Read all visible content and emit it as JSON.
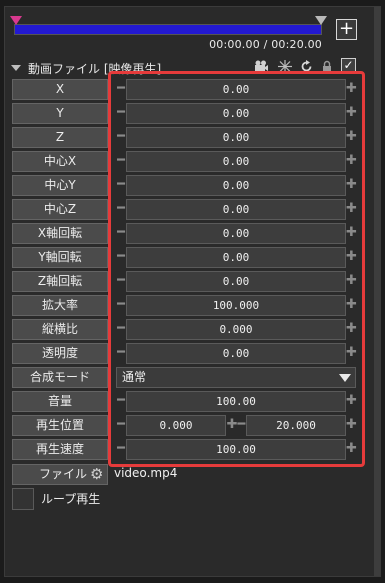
{
  "timeline": {
    "time": "00:00.00 / 00:20.00",
    "add_label": "+",
    "colors": {
      "track": "#2319d1",
      "start_marker": "#d8398f",
      "end_marker": "#b9b9b9"
    }
  },
  "section": {
    "title": "動画ファイル [映像再生]",
    "header_icons": [
      "camera-icon",
      "effect-icon",
      "refresh-icon",
      "lock-icon",
      "enable-checkbox"
    ],
    "checkbox_glyph": "✓"
  },
  "properties": [
    {
      "label": "X",
      "value": "0.00"
    },
    {
      "label": "Y",
      "value": "0.00"
    },
    {
      "label": "Z",
      "value": "0.00"
    },
    {
      "label": "中心X",
      "value": "0.00"
    },
    {
      "label": "中心Y",
      "value": "0.00"
    },
    {
      "label": "中心Z",
      "value": "0.00"
    },
    {
      "label": "X軸回転",
      "value": "0.00"
    },
    {
      "label": "Y軸回転",
      "value": "0.00"
    },
    {
      "label": "Z軸回転",
      "value": "0.00"
    },
    {
      "label": "拡大率",
      "value": "100.000"
    },
    {
      "label": "縦横比",
      "value": "0.000"
    },
    {
      "label": "透明度",
      "value": "0.00"
    }
  ],
  "blend": {
    "label": "合成モード",
    "value": "通常"
  },
  "volume": {
    "label": "音量",
    "value": "100.00"
  },
  "play_position": {
    "label": "再生位置",
    "start": "0.000",
    "end": "20.000"
  },
  "play_speed": {
    "label": "再生速度",
    "value": "100.00"
  },
  "file": {
    "label": "ファイル",
    "name": "video.mp4"
  },
  "loop": {
    "label": "ループ再生"
  },
  "highlight_color": "#e63b3b"
}
